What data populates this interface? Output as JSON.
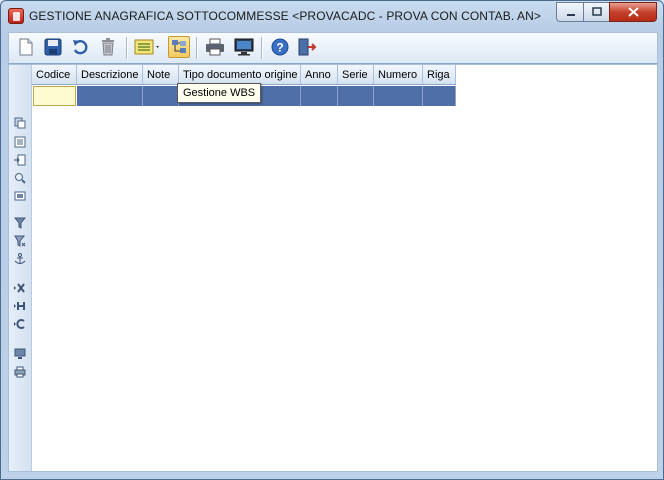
{
  "window": {
    "title": "GESTIONE ANAGRAFICA SOTTOCOMMESSE <PROVACADC - PROVA CON CONTAB. AN>",
    "controls": [
      "minimize",
      "maximize",
      "close"
    ]
  },
  "toolbar": {
    "buttons": [
      {
        "name": "new",
        "icon": "new-document-icon"
      },
      {
        "name": "save",
        "icon": "save-icon"
      },
      {
        "name": "undo",
        "icon": "undo-icon"
      },
      {
        "name": "delete",
        "icon": "trash-icon"
      },
      {
        "name": "list-options",
        "icon": "list-dropdown-icon"
      },
      {
        "name": "wbs",
        "icon": "wbs-tree-icon",
        "pressed": true
      },
      {
        "name": "print",
        "icon": "printer-icon"
      },
      {
        "name": "preview",
        "icon": "monitor-icon"
      },
      {
        "name": "help",
        "icon": "help-icon"
      },
      {
        "name": "exit",
        "icon": "exit-door-icon"
      }
    ]
  },
  "tooltip": {
    "text": "Gestione WBS"
  },
  "grid": {
    "columns": [
      "Codice",
      "Descrizione",
      "Note",
      "Tipo documento origine",
      "Anno",
      "Serie",
      "Numero",
      "Riga"
    ],
    "rows": [
      [
        "",
        "",
        "",
        "",
        "",
        "",
        "",
        ""
      ]
    ]
  },
  "sidebar": {
    "icons": [
      "paste-record-icon",
      "list-icon",
      "insert-icon",
      "zoom-icon",
      "form-view-icon",
      "filter-icon",
      "remove-filter-icon",
      "anchor-icon",
      "export-x-icon",
      "export-h-icon",
      "export-c-icon",
      "screen-output-icon",
      "print-output-icon"
    ]
  },
  "colors": {
    "selection_row": "#4f6fa8",
    "current_cell": "#fffbd0",
    "title_close": "#c7412c"
  }
}
